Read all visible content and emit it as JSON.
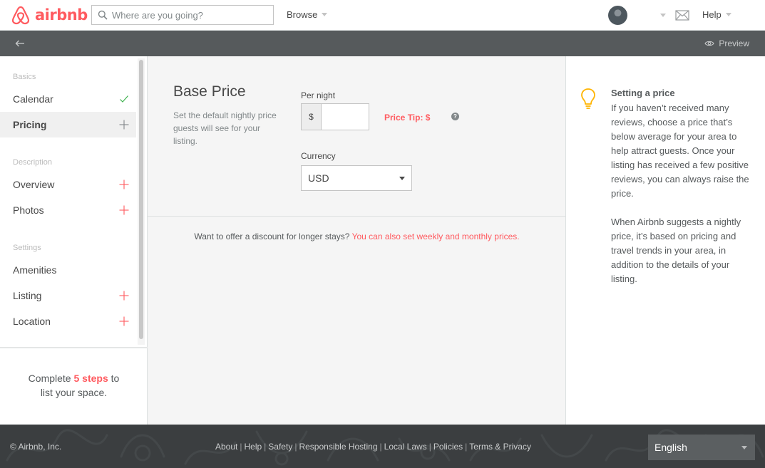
{
  "header": {
    "brand": "airbnb",
    "search_placeholder": "Where are you going?",
    "browse_label": "Browse",
    "help_label": "Help",
    "brand_color": "#ff5a5f"
  },
  "subheader": {
    "preview_label": "Preview"
  },
  "sidebar": {
    "sections": [
      {
        "label": "Basics"
      },
      {
        "label": "Description"
      },
      {
        "label": "Settings"
      }
    ],
    "items": [
      {
        "label": "Calendar",
        "status": "done"
      },
      {
        "label": "Pricing",
        "status": "active"
      },
      {
        "label": "Overview",
        "status": "todo"
      },
      {
        "label": "Photos",
        "status": "todo"
      },
      {
        "label": "Amenities",
        "status": "none"
      },
      {
        "label": "Listing",
        "status": "todo"
      },
      {
        "label": "Location",
        "status": "todo"
      }
    ],
    "steps": {
      "prefix": "Complete ",
      "highlight": "5 steps",
      "suffix": " to",
      "line2": "list your space."
    }
  },
  "main": {
    "title": "Base Price",
    "description": "Set the default nightly price guests will see for your listing.",
    "per_night_label": "Per night",
    "currency_symbol": "$",
    "per_night_value": "",
    "price_tip": "Price Tip: $",
    "help_glyph": "?",
    "currency_label": "Currency",
    "currency_value": "USD",
    "discount_text": "Want to offer a discount for longer stays? ",
    "discount_link": "You can also set weekly and monthly prices."
  },
  "tip": {
    "title": "Setting a price",
    "paragraphs": [
      "If you haven’t received many reviews, choose a price that’s below average for your area to help attract guests. Once your listing has received a few positive reviews, you can always raise the price.",
      "When Airbnb suggests a nightly price, it’s based on pricing and travel trends in your area, in addition to the details of your listing."
    ]
  },
  "footer": {
    "copyright": "© Airbnb, Inc.",
    "links": [
      "About",
      "Help",
      "Safety",
      "Responsible Hosting",
      "Local Laws",
      "Policies",
      "Terms & Privacy"
    ],
    "language": "English"
  }
}
